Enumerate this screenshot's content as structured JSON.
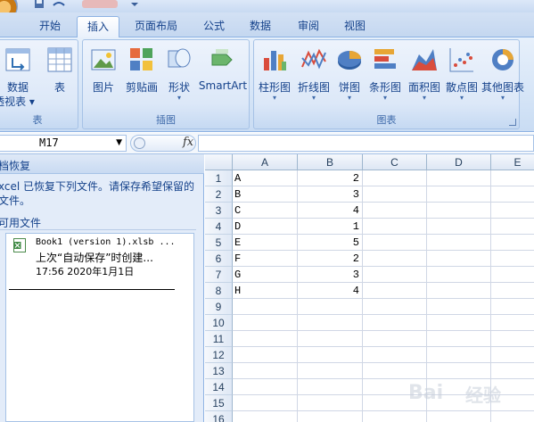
{
  "ribbon_tabs": [
    {
      "label": "开始",
      "active": false
    },
    {
      "label": "插入",
      "active": true
    },
    {
      "label": "页面布局",
      "active": false
    },
    {
      "label": "公式",
      "active": false
    },
    {
      "label": "数据",
      "active": false
    },
    {
      "label": "审阅",
      "active": false
    },
    {
      "label": "视图",
      "active": false
    }
  ],
  "ribbon": {
    "table_group": {
      "label": "表",
      "pivot_label": "数据",
      "pivot_label2": "透视表",
      "table_label": "表"
    },
    "illustrations_group": {
      "label": "插图",
      "buttons": [
        "图片",
        "剪贴画",
        "形状",
        "SmartArt"
      ]
    },
    "charts_group": {
      "label": "图表",
      "buttons": [
        "柱形图",
        "折线图",
        "饼图",
        "条形图",
        "面积图",
        "散点图",
        "其他图表"
      ]
    }
  },
  "formula_bar": {
    "name_box": "M17",
    "fx_label": "fx",
    "formula": ""
  },
  "recovery_pane": {
    "title": "档恢复",
    "description": "xcel 已恢复下列文件。请保存希望保留的文件。",
    "files_header": "可用文件",
    "file": {
      "name": "Book1 (version 1).xlsb ...",
      "status": "上次“自动保存”时创建...",
      "time": "17:56 2020年1月1日"
    }
  },
  "sheet": {
    "columns": [
      "A",
      "B",
      "C",
      "D",
      "E"
    ],
    "row_numbers": [
      "1",
      "2",
      "3",
      "4",
      "5",
      "6",
      "7",
      "8",
      "9",
      "10",
      "11",
      "12",
      "13",
      "14",
      "15",
      "16"
    ],
    "rows": [
      {
        "a": "A",
        "b": "2"
      },
      {
        "a": "B",
        "b": "3"
      },
      {
        "a": "C",
        "b": "4"
      },
      {
        "a": "D",
        "b": "1"
      },
      {
        "a": "E",
        "b": "5"
      },
      {
        "a": "F",
        "b": "2"
      },
      {
        "a": "G",
        "b": "3"
      },
      {
        "a": "H",
        "b": "4"
      }
    ]
  },
  "watermark": {
    "brand": "Bai",
    "site": "经验"
  },
  "colors": {
    "accent": "#15428b",
    "ribbon_bg": "#dce8f8",
    "grid_line": "#d0d7e5"
  }
}
